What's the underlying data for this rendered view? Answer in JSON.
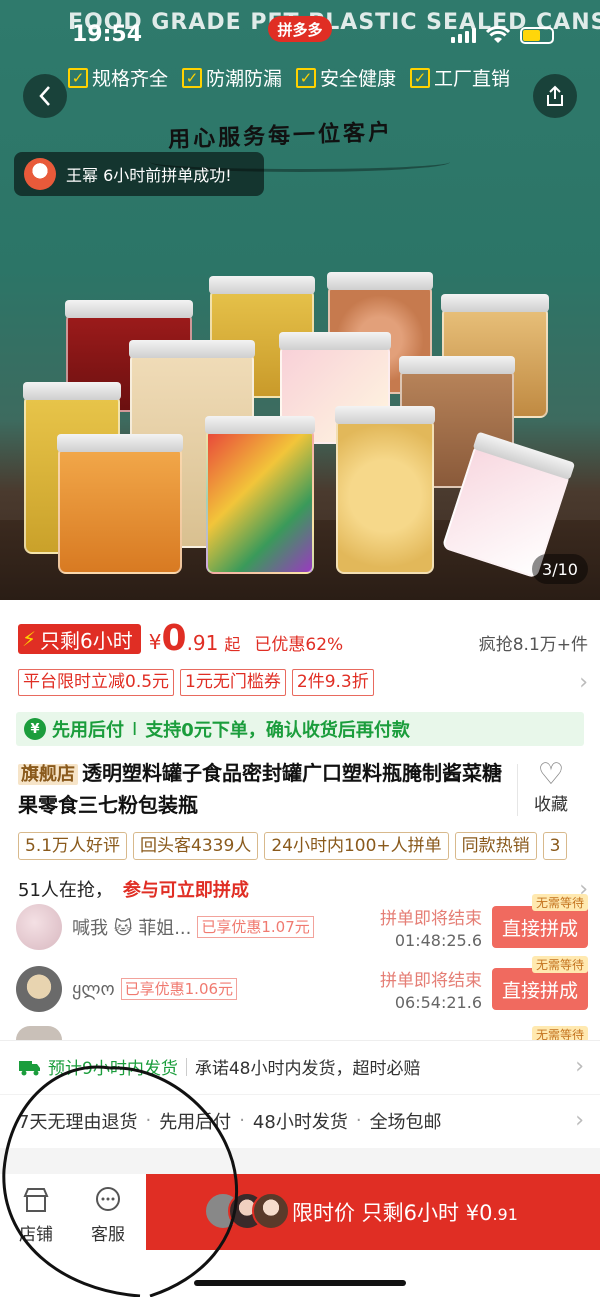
{
  "status_bar": {
    "time": "19:54"
  },
  "hero": {
    "banner_text": "FOOD GRADE PET PLASTIC SEALED CANS",
    "brand": "拼多多",
    "features": [
      "规格齐全",
      "防潮防漏",
      "安全健康",
      "工厂直销"
    ],
    "slogan": "用心服务每一位客户",
    "toast": "王幂 6小时前拼单成功!",
    "image_counter": "3/10"
  },
  "price": {
    "badge": "只剩6小时",
    "currency": "¥",
    "integer": "0",
    "decimal": ".91",
    "suffix": "起",
    "saved": "已优惠62%",
    "sold": "疯抢8.1万+件"
  },
  "coupons": [
    "平台限时立减0.5元",
    "1元无门槛券",
    "2件9.3折"
  ],
  "pay_later": {
    "label": "先用后付",
    "separator": "I",
    "desc": "支持0元下单，确认收货后再付款"
  },
  "product": {
    "store_badge": "旗舰店",
    "title": "透明塑料罐子食品密封罐广口塑料瓶腌制酱菜糖果零食三七粉包装瓶",
    "favorite_label": "收藏"
  },
  "tags": [
    "5.1万人好评",
    "回头客4339人",
    "24小时内100+人拼单",
    "同款热销",
    "3"
  ],
  "group_buy": {
    "count_text": "51人在抢，",
    "cta_text": "参与可立即拼成",
    "rows": [
      {
        "name": "喊我 🐱 菲姐...",
        "saved": "已享优惠1.07元",
        "status": "拼单即将结束",
        "countdown": "01:48:25.6",
        "button": "直接拼成",
        "badge": "无需等待"
      },
      {
        "name": "ყლო",
        "saved": "已享优惠1.06元",
        "status": "拼单即将结束",
        "countdown": "06:54:21.6",
        "button": "直接拼成",
        "badge": "无需等待"
      },
      {
        "badge": "无需等待"
      }
    ]
  },
  "shipping": {
    "eta": "预计9小时内发货",
    "promise": "承诺48小时内发货，超时必赔"
  },
  "services": [
    "7天无理由退货",
    "先用后付",
    "48小时发货",
    "全场包邮"
  ],
  "bottom_bar": {
    "store_label": "店铺",
    "service_label": "客服",
    "buy_label": "限时价 只剩6小时 ¥0",
    "buy_decimal": ".91"
  },
  "colors": {
    "brand_red": "#e02e24",
    "pay_green": "#1b9d3c"
  }
}
